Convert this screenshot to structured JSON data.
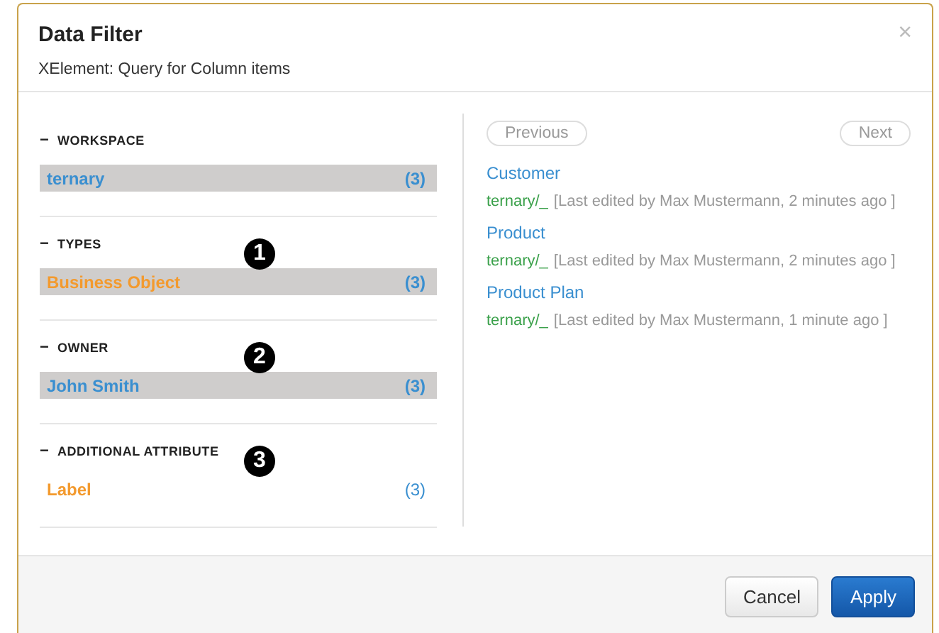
{
  "dialog": {
    "title": "Data Filter",
    "subtitle": "XElement: Query for Column items",
    "close": "×"
  },
  "filters": [
    {
      "heading": "WORKSPACE",
      "collapse": "−",
      "items": [
        {
          "label": "ternary",
          "count": "(3)",
          "selected": true,
          "color": "#3a8fd0"
        }
      ]
    },
    {
      "heading": "TYPES",
      "collapse": "−",
      "callout": "1",
      "items": [
        {
          "label": "Business Object",
          "count": "(3)",
          "selected": true,
          "color": "#f39a2e"
        }
      ]
    },
    {
      "heading": "OWNER",
      "collapse": "−",
      "callout": "2",
      "items": [
        {
          "label": "John Smith",
          "count": "(3)",
          "selected": true,
          "color": "#3a8fd0"
        }
      ]
    },
    {
      "heading": "ADDITIONAL ATTRIBUTE",
      "collapse": "−",
      "callout": "3",
      "items": [
        {
          "label": "Label",
          "count": "(3)",
          "selected": false,
          "color": "#f39a2e"
        }
      ]
    }
  ],
  "pager": {
    "previous": "Previous",
    "next": "Next"
  },
  "results": [
    {
      "name": "Customer",
      "path": "ternary/_",
      "meta": "[Last edited by Max Mustermann, 2 minutes ago ]"
    },
    {
      "name": "Product",
      "path": "ternary/_",
      "meta": "[Last edited by Max Mustermann, 2 minutes ago ]"
    },
    {
      "name": "Product Plan",
      "path": "ternary/_",
      "meta": "[Last edited by Max Mustermann, 1 minute ago ]"
    }
  ],
  "buttons": [
    {
      "label": "Cancel",
      "kind": "secondary"
    },
    {
      "label": "Apply",
      "kind": "primary"
    }
  ]
}
